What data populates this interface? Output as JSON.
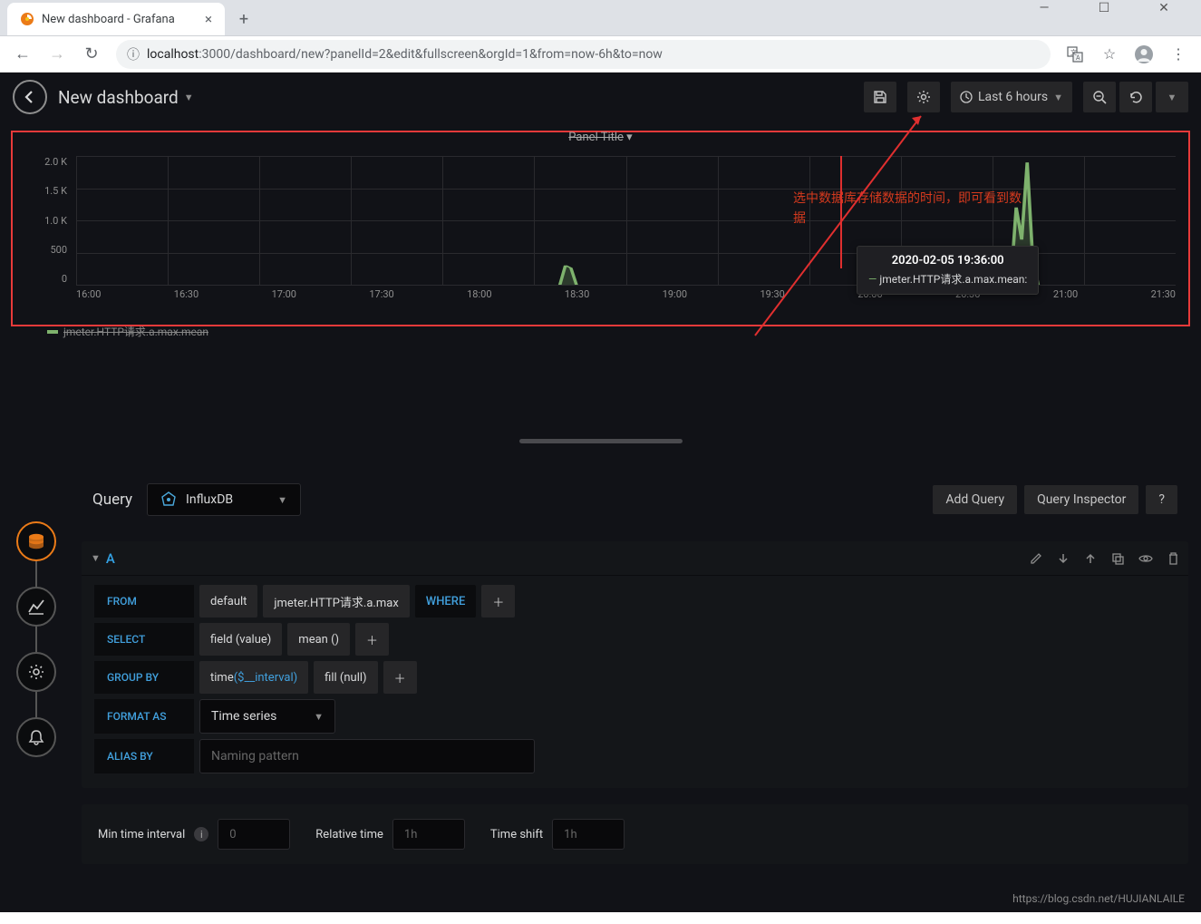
{
  "browser": {
    "tab_title": "New dashboard - Grafana",
    "url_info_prefix": "localhost",
    "url_rest": ":3000/dashboard/new?panelId=2&edit&fullscreen&orgId=1&from=now-6h&to=now"
  },
  "header": {
    "dashboard_title": "New dashboard",
    "time_range": "Last 6 hours"
  },
  "chart_data": {
    "type": "line",
    "title": "Panel Title",
    "ylabel": "",
    "ylim": [
      0,
      2000
    ],
    "yticks": [
      "2.0 K",
      "1.5 K",
      "1.0 K",
      "500",
      "0"
    ],
    "xticks": [
      "16:00",
      "16:30",
      "17:00",
      "17:30",
      "18:00",
      "18:30",
      "19:00",
      "19:30",
      "20:00",
      "20:30",
      "21:00",
      "21:30"
    ],
    "series": [
      {
        "name": "jmeter.HTTP请求.a.max.mean",
        "color": "#7eb26d",
        "x": [
          "18:35",
          "18:36",
          "18:37",
          "18:38",
          "20:54",
          "20:55",
          "20:56",
          "20:57",
          "20:58"
        ],
        "values": [
          0,
          300,
          250,
          0,
          0,
          1200,
          700,
          1900,
          400
        ]
      }
    ],
    "marker_x": "19:36",
    "tooltip": {
      "time": "2020-02-05 19:36:00",
      "series": "jmeter.HTTP请求.a.max.mean:"
    },
    "legend": [
      "jmeter.HTTP请求.a.max.mean"
    ]
  },
  "annotation": {
    "line1": "选中数据库存储数据的时间，即可看到数",
    "line2": "据"
  },
  "query": {
    "section_label": "Query",
    "datasource": "InfluxDB",
    "add_query": "Add Query",
    "inspector": "Query Inspector",
    "help_symbol": "?",
    "row_letter": "A",
    "from": {
      "key": "FROM",
      "db": "default",
      "measurement": "jmeter.HTTP请求.a.max",
      "where": "WHERE"
    },
    "select": {
      "key": "SELECT",
      "field": "field (value)",
      "agg": "mean ()"
    },
    "groupby": {
      "key": "GROUP BY",
      "time_label": "time",
      "time_param": "($__interval)",
      "fill": "fill (null)"
    },
    "format": {
      "key": "FORMAT AS",
      "value": "Time series"
    },
    "alias": {
      "key": "ALIAS BY",
      "placeholder": "Naming pattern"
    }
  },
  "time_opts": {
    "min_interval_label": "Min time interval",
    "min_interval_placeholder": "0",
    "relative_label": "Relative time",
    "relative_placeholder": "1h",
    "shift_label": "Time shift",
    "shift_placeholder": "1h"
  },
  "watermark": "https://blog.csdn.net/HUJIANLAILE"
}
